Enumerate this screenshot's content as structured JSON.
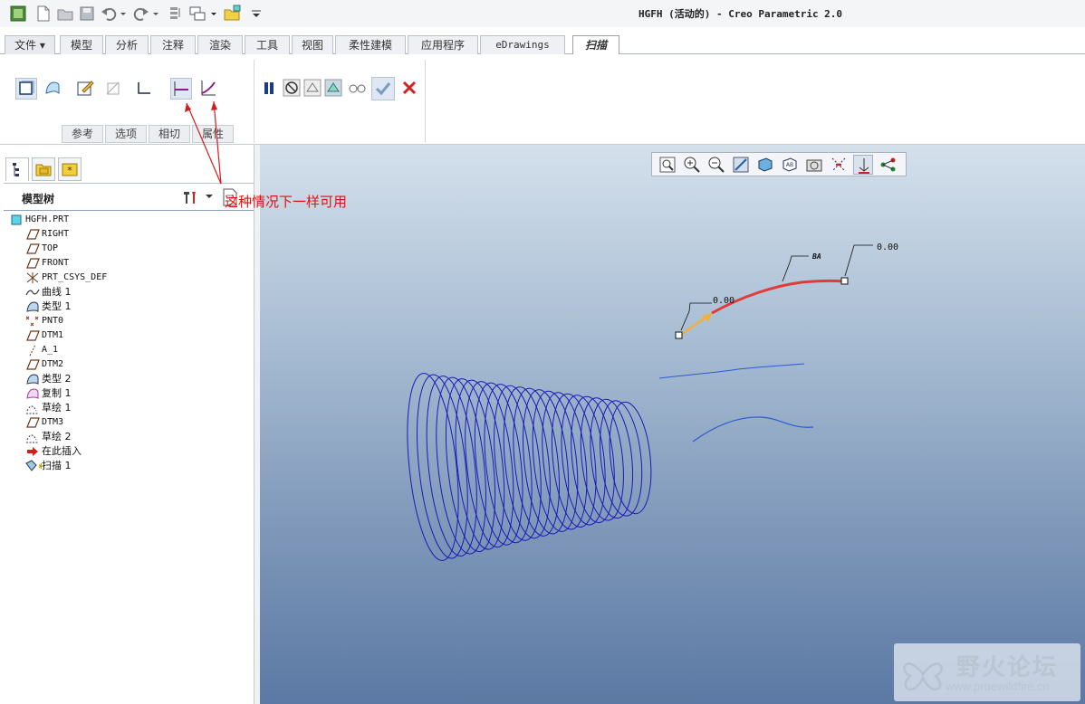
{
  "window": {
    "title": "HGFH (活动的) - Creo Parametric 2.0"
  },
  "ribbon_tabs": [
    "文件 ▾",
    "模型",
    "分析",
    "注释",
    "渲染",
    "工具",
    "视图",
    "柔性建模",
    "应用程序",
    "eDrawings",
    "扫描"
  ],
  "active_tab": "扫描",
  "sweep_dashboard": {
    "subtabs": [
      "参考",
      "选项",
      "相切",
      "属性"
    ],
    "buttons": [
      {
        "name": "solid-button",
        "icon": "solid-icon",
        "pressed": true
      },
      {
        "name": "surface-button",
        "icon": "surface-icon",
        "pressed": false
      },
      {
        "name": "sketch-button",
        "icon": "sketch-icon",
        "pressed": false
      },
      {
        "name": "remove-material-button",
        "icon": "remove-material-icon",
        "pressed": false
      },
      {
        "name": "thicken-button",
        "icon": "thicken-icon",
        "pressed": false
      },
      {
        "name": "constant-section-button",
        "icon": "constant-section-icon",
        "pressed": true
      },
      {
        "name": "variable-section-button",
        "icon": "variable-section-icon",
        "pressed": false
      }
    ],
    "control_buttons": [
      "pause-icon",
      "no-preview-icon",
      "preview-icon",
      "verify-icon",
      "glasses-icon",
      "ok-check-icon",
      "cancel-x-icon"
    ]
  },
  "annotation": {
    "text": "这种情况下一样可用",
    "color": "#e01010"
  },
  "navigator": {
    "tabs": [
      "model-tree-icon",
      "folder-browser-icon",
      "favorites-icon"
    ],
    "title": "模型树",
    "items": [
      {
        "label": "HGFH.PRT",
        "icon": "part-icon",
        "level": 0
      },
      {
        "label": "RIGHT",
        "icon": "datum-plane-icon",
        "level": 1
      },
      {
        "label": "TOP",
        "icon": "datum-plane-icon",
        "level": 1
      },
      {
        "label": "FRONT",
        "icon": "datum-plane-icon",
        "level": 1
      },
      {
        "label": "PRT_CSYS_DEF",
        "icon": "csys-icon",
        "level": 1
      },
      {
        "label": "曲线 1",
        "icon": "curve-icon",
        "level": 1
      },
      {
        "label": "类型 1",
        "icon": "feature-icon",
        "level": 1
      },
      {
        "label": "PNT0",
        "icon": "datum-point-icon",
        "level": 1
      },
      {
        "label": "DTM1",
        "icon": "datum-plane-icon",
        "level": 1
      },
      {
        "label": "A_1",
        "icon": "datum-axis-icon",
        "level": 1
      },
      {
        "label": "DTM2",
        "icon": "datum-plane-icon",
        "level": 1
      },
      {
        "label": "类型 2",
        "icon": "feature-icon",
        "level": 1
      },
      {
        "label": "复制 1",
        "icon": "copy-icon",
        "level": 1
      },
      {
        "label": "草绘 1",
        "icon": "sketch-feature-icon",
        "level": 1
      },
      {
        "label": "DTM3",
        "icon": "datum-plane-icon",
        "level": 1
      },
      {
        "label": "草绘 2",
        "icon": "sketch-feature-icon",
        "level": 1
      },
      {
        "label": "在此插入",
        "icon": "insert-here-arrow-icon",
        "level": 1
      },
      {
        "label": "扫描 1",
        "icon": "sweep-icon",
        "level": 1
      }
    ]
  },
  "graphics": {
    "toolbar": [
      "refit-icon",
      "zoom-in-icon",
      "zoom-out-icon",
      "repaint-icon",
      "display-style-icon",
      "saved-views-icon",
      "view-manager-icon",
      "datum-display-icon",
      "spin-center-icon",
      "annotation-display-icon"
    ],
    "dimensions": {
      "start": "0.00",
      "end": "0.00",
      "tag": "ВА"
    },
    "colors": {
      "helix": "#1a1ab8",
      "trajectory": "#e23a3a",
      "curve": "#2a5ad0",
      "start_arrow": "#f0b040"
    }
  },
  "watermark": {
    "cn": "野火论坛",
    "url": "www.proewildfire.cn"
  }
}
